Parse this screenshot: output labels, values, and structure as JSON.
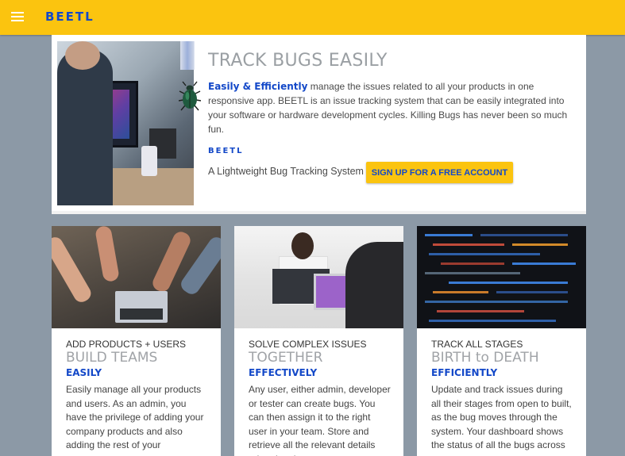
{
  "app": {
    "brand": "BEETL",
    "menu_icon": "hamburger-menu-icon",
    "colors": {
      "topbar": "#fbc40f",
      "brand_blue": "#1348c8",
      "page_bg": "#8c99a6"
    }
  },
  "hero": {
    "title": "TRACK BUGS EASILY",
    "lead_bold": "Easily & Efficiently",
    "lead_text": " manage the issues related to all your products in one responsive app. BEETL is an issue tracking system that can be easily integrated into your software or hardware development cycles. Killing Bugs has never been so much fun.",
    "brand": "BEETL",
    "tagline": "A Lightweight Bug Tracking System",
    "cta_label": "SIGN UP FOR A FREE ACCOUNT",
    "icon": "beetle-icon"
  },
  "cards": [
    {
      "label": "ADD PRODUCTS + USERS",
      "title": "BUILD TEAMS",
      "emphasis": "EASILY",
      "body": "Easily manage all your products and users. As an admin, you have the privilege of adding your company products and also adding the rest of your"
    },
    {
      "label": "SOLVE COMPLEX ISSUES",
      "title": "TOGETHER",
      "emphasis": "EFFECTIVELY",
      "body": "Any user, either admin, developer or tester can create bugs. You can then assign it to the right user in your team. Store and retrieve all the relevant details related to the"
    },
    {
      "label": "TRACK ALL STAGES",
      "title": "BIRTH to DEATH",
      "emphasis": "EFFICIENTLY",
      "body": "Update and track issues during all their stages from open to built, as the bug moves through the system. Your dashboard shows the status of all the bugs across"
    }
  ]
}
